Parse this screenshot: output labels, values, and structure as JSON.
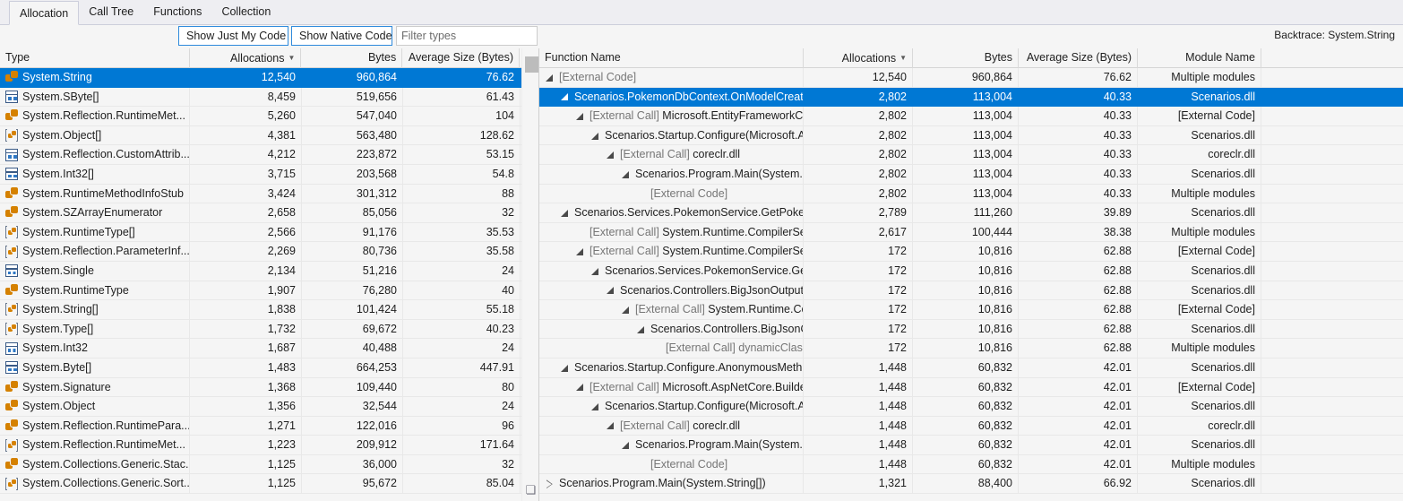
{
  "tabs": [
    {
      "label": "Allocation",
      "active": true
    },
    {
      "label": "Call Tree",
      "active": false
    },
    {
      "label": "Functions",
      "active": false
    },
    {
      "label": "Collection",
      "active": false
    }
  ],
  "toolbar": {
    "just_my_code_label": "Show Just My Code",
    "native_code_label": "Show Native Code",
    "filter_placeholder": "Filter types",
    "filter_value": "",
    "backtrace_label": "Backtrace: System.String"
  },
  "types_grid": {
    "columns": [
      {
        "label": "Type",
        "align": "left",
        "sorted": false
      },
      {
        "label": "Allocations",
        "align": "right",
        "sorted": true
      },
      {
        "label": "Bytes",
        "align": "right",
        "sorted": false
      },
      {
        "label": "Average Size (Bytes)",
        "align": "right",
        "sorted": false
      }
    ],
    "sort_glyph": "▼",
    "rows": [
      {
        "icon": "class-icon",
        "type": "System.String",
        "allocations": "12,540",
        "bytes": "960,864",
        "avg": "76.62",
        "selected": true
      },
      {
        "icon": "struct-icon",
        "type": "System.SByte[]",
        "allocations": "8,459",
        "bytes": "519,656",
        "avg": "61.43",
        "selected": false
      },
      {
        "icon": "class-icon",
        "type": "System.Reflection.RuntimeMet...",
        "allocations": "5,260",
        "bytes": "547,040",
        "avg": "104",
        "selected": false
      },
      {
        "icon": "array-icon",
        "type": "System.Object[]",
        "allocations": "4,381",
        "bytes": "563,480",
        "avg": "128.62",
        "selected": false
      },
      {
        "icon": "struct-icon",
        "type": "System.Reflection.CustomAttrib...",
        "allocations": "4,212",
        "bytes": "223,872",
        "avg": "53.15",
        "selected": false
      },
      {
        "icon": "struct-icon",
        "type": "System.Int32[]",
        "allocations": "3,715",
        "bytes": "203,568",
        "avg": "54.8",
        "selected": false
      },
      {
        "icon": "class-icon",
        "type": "System.RuntimeMethodInfoStub",
        "allocations": "3,424",
        "bytes": "301,312",
        "avg": "88",
        "selected": false
      },
      {
        "icon": "class-icon",
        "type": "System.SZArrayEnumerator",
        "allocations": "2,658",
        "bytes": "85,056",
        "avg": "32",
        "selected": false
      },
      {
        "icon": "array-icon",
        "type": "System.RuntimeType[]",
        "allocations": "2,566",
        "bytes": "91,176",
        "avg": "35.53",
        "selected": false
      },
      {
        "icon": "array-icon",
        "type": "System.Reflection.ParameterInf...",
        "allocations": "2,269",
        "bytes": "80,736",
        "avg": "35.58",
        "selected": false
      },
      {
        "icon": "value-icon",
        "type": "System.Single",
        "allocations": "2,134",
        "bytes": "51,216",
        "avg": "24",
        "selected": false
      },
      {
        "icon": "class-icon",
        "type": "System.RuntimeType",
        "allocations": "1,907",
        "bytes": "76,280",
        "avg": "40",
        "selected": false
      },
      {
        "icon": "array-icon",
        "type": "System.String[]",
        "allocations": "1,838",
        "bytes": "101,424",
        "avg": "55.18",
        "selected": false
      },
      {
        "icon": "array-icon",
        "type": "System.Type[]",
        "allocations": "1,732",
        "bytes": "69,672",
        "avg": "40.23",
        "selected": false
      },
      {
        "icon": "value-icon",
        "type": "System.Int32",
        "allocations": "1,687",
        "bytes": "40,488",
        "avg": "24",
        "selected": false
      },
      {
        "icon": "struct-icon",
        "type": "System.Byte[]",
        "allocations": "1,483",
        "bytes": "664,253",
        "avg": "447.91",
        "selected": false
      },
      {
        "icon": "class-icon",
        "type": "System.Signature",
        "allocations": "1,368",
        "bytes": "109,440",
        "avg": "80",
        "selected": false
      },
      {
        "icon": "class-icon",
        "type": "System.Object",
        "allocations": "1,356",
        "bytes": "32,544",
        "avg": "24",
        "selected": false
      },
      {
        "icon": "class-icon",
        "type": "System.Reflection.RuntimePara...",
        "allocations": "1,271",
        "bytes": "122,016",
        "avg": "96",
        "selected": false
      },
      {
        "icon": "array-icon",
        "type": "System.Reflection.RuntimeMet...",
        "allocations": "1,223",
        "bytes": "209,912",
        "avg": "171.64",
        "selected": false
      },
      {
        "icon": "class-icon",
        "type": "System.Collections.Generic.Stac...",
        "allocations": "1,125",
        "bytes": "36,000",
        "avg": "32",
        "selected": false
      },
      {
        "icon": "array-icon",
        "type": "System.Collections.Generic.Sort...",
        "allocations": "1,125",
        "bytes": "95,672",
        "avg": "85.04",
        "selected": false
      }
    ]
  },
  "backtrace_grid": {
    "columns": [
      {
        "label": "Function Name",
        "align": "left",
        "sorted": false
      },
      {
        "label": "Allocations",
        "align": "right",
        "sorted": true
      },
      {
        "label": "Bytes",
        "align": "right",
        "sorted": false
      },
      {
        "label": "Average Size (Bytes)",
        "align": "right",
        "sorted": false
      },
      {
        "label": "Module Name",
        "align": "right",
        "sorted": false
      }
    ],
    "sort_glyph": "▼",
    "rows": [
      {
        "depth": 0,
        "expander": "open",
        "prefix": "",
        "name": "[External Code]",
        "dim": true,
        "allocations": "12,540",
        "bytes": "960,864",
        "avg": "76.62",
        "module": "Multiple modules",
        "selected": false
      },
      {
        "depth": 1,
        "expander": "open",
        "prefix": "",
        "name": "Scenarios.PokemonDbContext.OnModelCreat...",
        "dim": false,
        "allocations": "2,802",
        "bytes": "113,004",
        "avg": "40.33",
        "module": "Scenarios.dll",
        "selected": true
      },
      {
        "depth": 2,
        "expander": "open",
        "prefix": "[External Call] ",
        "name": "Microsoft.EntityFrameworkC...",
        "dim": false,
        "allocations": "2,802",
        "bytes": "113,004",
        "avg": "40.33",
        "module": "[External Code]",
        "selected": false
      },
      {
        "depth": 3,
        "expander": "open",
        "prefix": "",
        "name": "Scenarios.Startup.Configure(Microsoft.As...",
        "dim": false,
        "allocations": "2,802",
        "bytes": "113,004",
        "avg": "40.33",
        "module": "Scenarios.dll",
        "selected": false
      },
      {
        "depth": 4,
        "expander": "open",
        "prefix": "[External Call] ",
        "name": "coreclr.dll",
        "dim": false,
        "allocations": "2,802",
        "bytes": "113,004",
        "avg": "40.33",
        "module": "coreclr.dll",
        "selected": false
      },
      {
        "depth": 5,
        "expander": "open",
        "prefix": "",
        "name": "Scenarios.Program.Main(System.Stri...",
        "dim": false,
        "allocations": "2,802",
        "bytes": "113,004",
        "avg": "40.33",
        "module": "Scenarios.dll",
        "selected": false
      },
      {
        "depth": 6,
        "expander": "none",
        "prefix": "",
        "name": "[External Code]",
        "dim": true,
        "allocations": "2,802",
        "bytes": "113,004",
        "avg": "40.33",
        "module": "Multiple modules",
        "selected": false
      },
      {
        "depth": 1,
        "expander": "open",
        "prefix": "",
        "name": "Scenarios.Services.PokemonService.GetPoke...",
        "dim": false,
        "allocations": "2,789",
        "bytes": "111,260",
        "avg": "39.89",
        "module": "Scenarios.dll",
        "selected": false
      },
      {
        "depth": 2,
        "expander": "none",
        "prefix": "[External Call] ",
        "name": "System.Runtime.CompilerSer...",
        "dim": false,
        "allocations": "2,617",
        "bytes": "100,444",
        "avg": "38.38",
        "module": "Multiple modules",
        "selected": false
      },
      {
        "depth": 2,
        "expander": "open",
        "prefix": "[External Call] ",
        "name": "System.Runtime.CompilerSer...",
        "dim": false,
        "allocations": "172",
        "bytes": "10,816",
        "avg": "62.88",
        "module": "[External Code]",
        "selected": false
      },
      {
        "depth": 3,
        "expander": "open",
        "prefix": "",
        "name": "Scenarios.Services.PokemonService.GetP...",
        "dim": false,
        "allocations": "172",
        "bytes": "10,816",
        "avg": "62.88",
        "module": "Scenarios.dll",
        "selected": false
      },
      {
        "depth": 4,
        "expander": "open",
        "prefix": "",
        "name": "Scenarios.Controllers.BigJsonOutputC...",
        "dim": false,
        "allocations": "172",
        "bytes": "10,816",
        "avg": "62.88",
        "module": "Scenarios.dll",
        "selected": false
      },
      {
        "depth": 5,
        "expander": "open",
        "prefix": "[External Call] ",
        "name": "System.Runtime.Com...",
        "dim": false,
        "allocations": "172",
        "bytes": "10,816",
        "avg": "62.88",
        "module": "[External Code]",
        "selected": false
      },
      {
        "depth": 6,
        "expander": "open",
        "prefix": "",
        "name": "Scenarios.Controllers.BigJsonOutp...",
        "dim": false,
        "allocations": "172",
        "bytes": "10,816",
        "avg": "62.88",
        "module": "Scenarios.dll",
        "selected": false
      },
      {
        "depth": 7,
        "expander": "none",
        "prefix": "[External Call] ",
        "name": "dynamicClass.lam...",
        "dim": true,
        "allocations": "172",
        "bytes": "10,816",
        "avg": "62.88",
        "module": "Multiple modules",
        "selected": false
      },
      {
        "depth": 1,
        "expander": "open",
        "prefix": "",
        "name": "Scenarios.Startup.Configure.AnonymousMeth...",
        "dim": false,
        "allocations": "1,448",
        "bytes": "60,832",
        "avg": "42.01",
        "module": "Scenarios.dll",
        "selected": false
      },
      {
        "depth": 2,
        "expander": "open",
        "prefix": "[External Call] ",
        "name": "Microsoft.AspNetCore.Builde...",
        "dim": false,
        "allocations": "1,448",
        "bytes": "60,832",
        "avg": "42.01",
        "module": "[External Code]",
        "selected": false
      },
      {
        "depth": 3,
        "expander": "open",
        "prefix": "",
        "name": "Scenarios.Startup.Configure(Microsoft.As...",
        "dim": false,
        "allocations": "1,448",
        "bytes": "60,832",
        "avg": "42.01",
        "module": "Scenarios.dll",
        "selected": false
      },
      {
        "depth": 4,
        "expander": "open",
        "prefix": "[External Call] ",
        "name": "coreclr.dll",
        "dim": false,
        "allocations": "1,448",
        "bytes": "60,832",
        "avg": "42.01",
        "module": "coreclr.dll",
        "selected": false
      },
      {
        "depth": 5,
        "expander": "open",
        "prefix": "",
        "name": "Scenarios.Program.Main(System.Stri...",
        "dim": false,
        "allocations": "1,448",
        "bytes": "60,832",
        "avg": "42.01",
        "module": "Scenarios.dll",
        "selected": false
      },
      {
        "depth": 6,
        "expander": "none",
        "prefix": "",
        "name": "[External Code]",
        "dim": true,
        "allocations": "1,448",
        "bytes": "60,832",
        "avg": "42.01",
        "module": "Multiple modules",
        "selected": false
      },
      {
        "depth": 0,
        "expander": "closed",
        "prefix": "",
        "name": "Scenarios.Program.Main(System.String[])",
        "dim": false,
        "allocations": "1,321",
        "bytes": "88,400",
        "avg": "66.92",
        "module": "Scenarios.dll",
        "selected": false
      }
    ]
  },
  "colors": {
    "selection": "#0078d4",
    "class_icon": "#d58100",
    "struct_icon": "#3a5a86",
    "button_border": "#2e8adc"
  }
}
